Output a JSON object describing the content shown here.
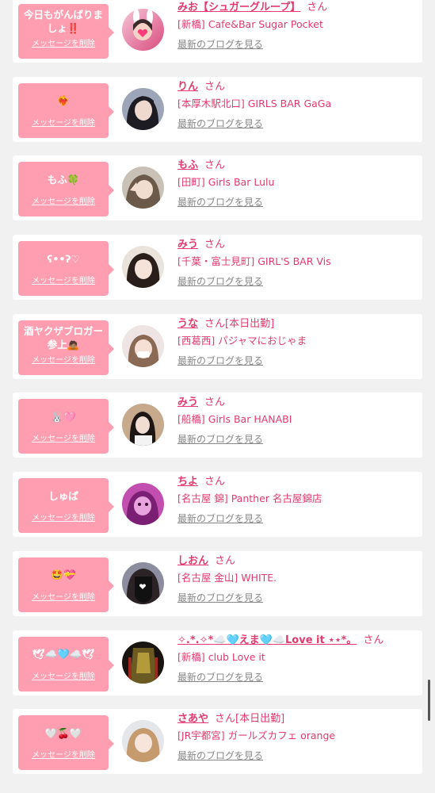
{
  "entries": [
    {
      "message": "今日もがんばりましょ‼️",
      "delete_label": "メッセージを削除",
      "name": "みお【シュガーグループ】",
      "san": "さん",
      "shop": "[新橋] Cafe&Bar Sugar Pocket",
      "blog_label": "最新のブログを見る"
    },
    {
      "message": "❤️‍🔥",
      "delete_label": "メッセージを削除",
      "name": "りん",
      "san": "さん",
      "shop": "[本厚木駅北口] GIRLS BAR GaGa",
      "blog_label": "最新のブログを見る"
    },
    {
      "message": "もふ🍀",
      "delete_label": "メッセージを削除",
      "name": "もふ",
      "san": "さん",
      "shop": "[田町] Girls Bar Lulu",
      "blog_label": "最新のブログを見る"
    },
    {
      "message": "ʕ••ʔ♡",
      "delete_label": "メッセージを削除",
      "name": "みう",
      "san": "さん",
      "shop": "[千葉・富士見町] GIRL'S BAR Vis",
      "blog_label": "最新のブログを見る"
    },
    {
      "message": "酒ヤクザブロガー参上🙇🏽",
      "delete_label": "メッセージを削除",
      "name": "うな",
      "san": "さん[本日出勤]",
      "shop": "[西葛西] パジャマにおじゃま",
      "blog_label": "最新のブログを見る"
    },
    {
      "message": "🐰🩷",
      "delete_label": "メッセージを削除",
      "name": "みう",
      "san": "さん",
      "shop": "[船橋] Girls Bar HANABI",
      "blog_label": "最新のブログを見る"
    },
    {
      "message": "しゅぱ",
      "delete_label": "メッセージを削除",
      "name": "ちよ",
      "san": "さん",
      "shop": "[名古屋 錦] Panther 名古屋錦店",
      "blog_label": "最新のブログを見る"
    },
    {
      "message": "🤩💝",
      "delete_label": "メッセージを削除",
      "name": "しおん",
      "san": "さん",
      "shop": "[名古屋 金山] WHITE.",
      "blog_label": "最新のブログを見る"
    },
    {
      "message": "🕊☁️🩵☁️🕊",
      "delete_label": "メッセージを削除",
      "name": "✧.*.✧*☁️🩵えま🩵☁️Love it ⋆⋆*。",
      "san": "さん",
      "shop": "[新橋] club Love it",
      "blog_label": "最新のブログを見る"
    },
    {
      "message": "🤍🍒🤍",
      "delete_label": "メッセージを削除",
      "name": "さあや",
      "san": "さん[本日出勤]",
      "shop": "[JR宇都宮] ガールズカフェ orange",
      "blog_label": "最新のブログを見る"
    }
  ],
  "colors": {
    "accent": "#e23a6e",
    "bubble": "#ff9eb0",
    "background": "#f1f1f2",
    "muted": "#888888"
  }
}
